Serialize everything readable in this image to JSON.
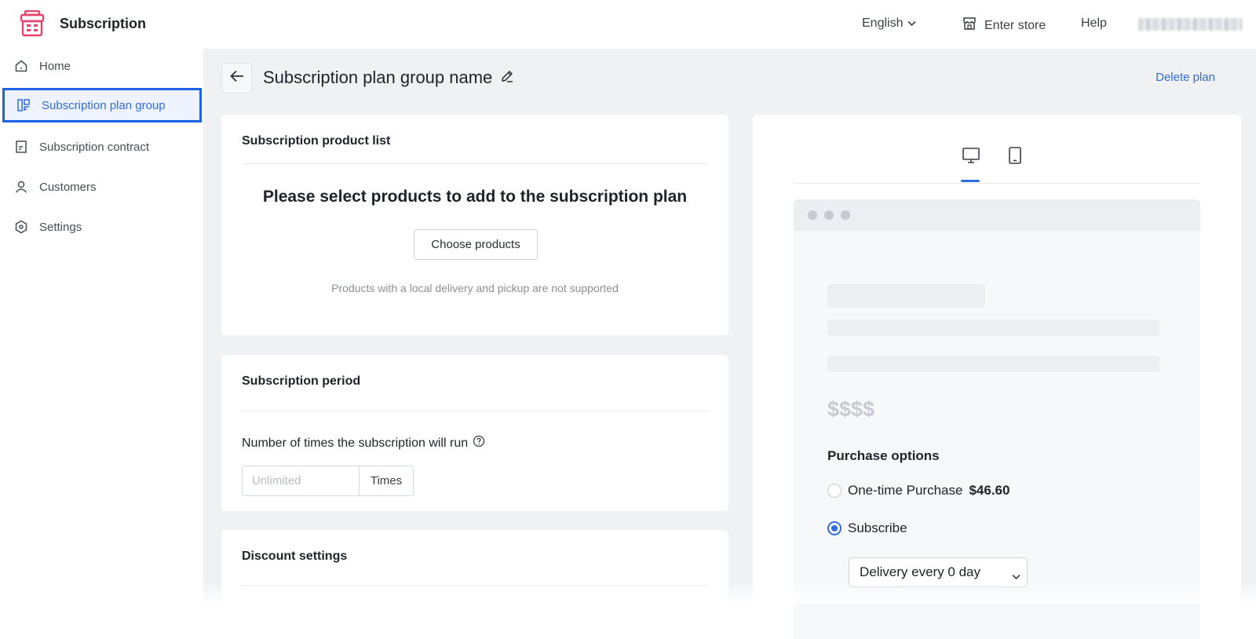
{
  "header": {
    "app_title": "Subscription",
    "language": "English",
    "enter_store": "Enter store",
    "help": "Help"
  },
  "sidebar": {
    "items": [
      {
        "label": "Home",
        "icon": "home-icon",
        "active": false
      },
      {
        "label": "Subscription plan group",
        "icon": "layout-icon",
        "active": true
      },
      {
        "label": "Subscription contract",
        "icon": "document-icon",
        "active": false
      },
      {
        "label": "Customers",
        "icon": "user-icon",
        "active": false
      },
      {
        "label": "Settings",
        "icon": "settings-icon",
        "active": false
      }
    ]
  },
  "page": {
    "title": "Subscription plan group name",
    "delete_label": "Delete plan"
  },
  "product_list": {
    "title": "Subscription product list",
    "empty_title": "Please select products to add to the subscription plan",
    "choose_button": "Choose products",
    "hint": "Products with a local delivery and pickup are not supported"
  },
  "period": {
    "title": "Subscription period",
    "field_label": "Number of times the subscription will run",
    "placeholder": "Unlimited",
    "suffix": "Times"
  },
  "discount": {
    "title": "Discount settings"
  },
  "preview": {
    "active_device": "desktop",
    "price_placeholder": "$$$$",
    "purchase_title": "Purchase options",
    "one_time_label": "One-time Purchase",
    "one_time_price": "$46.60",
    "subscribe_label": "Subscribe",
    "subscribe_selected": true,
    "delivery_option": "Delivery every 0 day"
  },
  "colors": {
    "accent": "#2f6be6",
    "brand": "#e8416b",
    "background": "#f0f1f3"
  }
}
